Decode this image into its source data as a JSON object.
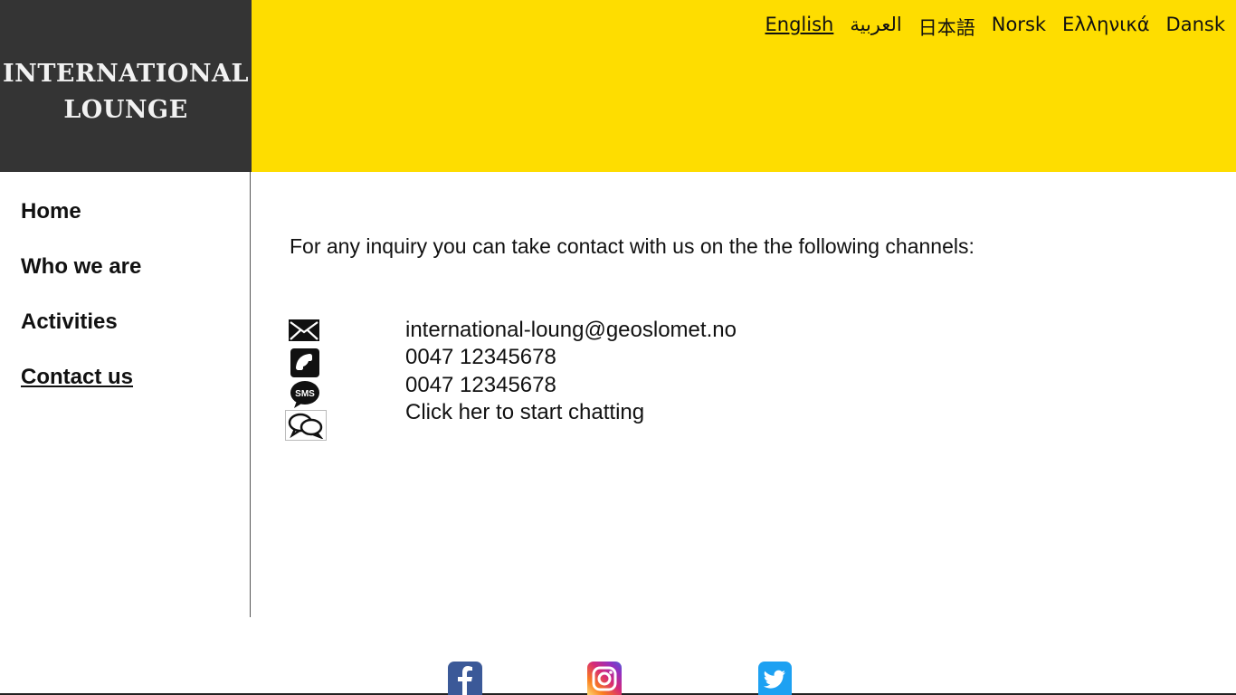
{
  "brand": {
    "logo_text": "INTERNATIONAL\nLOUNGE"
  },
  "languages": [
    {
      "label": "English",
      "active": true
    },
    {
      "label": "العربية",
      "active": false
    },
    {
      "label": "日本語",
      "active": false
    },
    {
      "label": "Norsk",
      "active": false
    },
    {
      "label": "Ελληνικά",
      "active": false
    },
    {
      "label": "Dansk",
      "active": false
    }
  ],
  "nav": {
    "items": [
      {
        "label": "Home"
      },
      {
        "label": "Who we are"
      },
      {
        "label": "Activities"
      },
      {
        "label": "Contact us",
        "active": true
      }
    ]
  },
  "main": {
    "intro": "For any inquiry you can take contact with us on the the following channels:",
    "contacts": [
      {
        "icon": "envelope-icon",
        "text": "international-loung@geoslomet.no"
      },
      {
        "icon": "phone-icon",
        "text": "0047 12345678"
      },
      {
        "icon": "sms-icon",
        "text": "0047 12345678"
      },
      {
        "icon": "chat-icon",
        "text": "Click her to start chatting"
      }
    ]
  },
  "footer": {
    "social": [
      {
        "icon": "facebook-icon"
      },
      {
        "icon": "instagram-icon"
      },
      {
        "icon": "twitter-icon"
      }
    ]
  },
  "colors": {
    "header_yellow": "#fedd00",
    "logo_background": "#343434",
    "facebook_blue": "#3b5998",
    "twitter_blue": "#1da1f2"
  }
}
